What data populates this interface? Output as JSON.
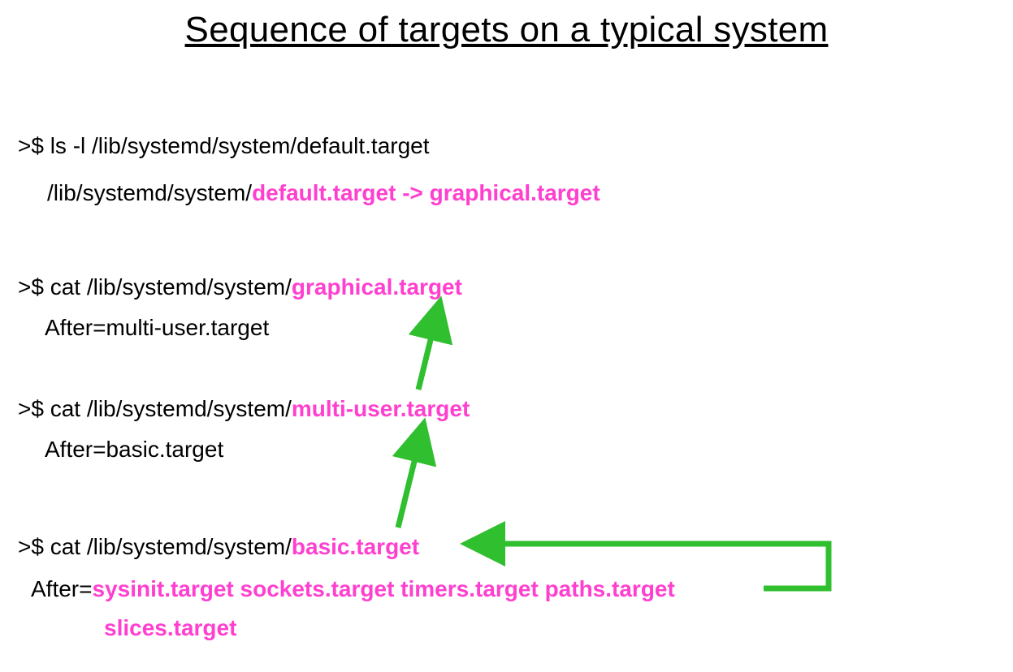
{
  "title": "Sequence of targets on a typical system",
  "colors": {
    "highlight": "#ff3fcf",
    "arrow": "#2fbf2f",
    "text": "#000000"
  },
  "block1": {
    "cmd_prompt": ">$ ",
    "cmd_text": "ls -l /lib/systemd/system/default.target",
    "out_plain": "/lib/systemd/system/",
    "out_hl": "default.target -> graphical.target"
  },
  "block2": {
    "cmd_prompt": ">$ ",
    "cmd_plain": "cat /lib/systemd/system/",
    "cmd_hl": "graphical.target",
    "out": "After=multi-user.target"
  },
  "block3": {
    "cmd_prompt": ">$ ",
    "cmd_plain": "cat /lib/systemd/system/",
    "cmd_hl": "multi-user.target",
    "out": "After=basic.target"
  },
  "block4": {
    "cmd_prompt": ">$ ",
    "cmd_plain": "cat /lib/systemd/system/",
    "cmd_hl": "basic.target",
    "out_prefix": "After=",
    "out_hl_line1": "sysinit.target sockets.target timers.target paths.target",
    "out_hl_line2": "slices.target"
  }
}
